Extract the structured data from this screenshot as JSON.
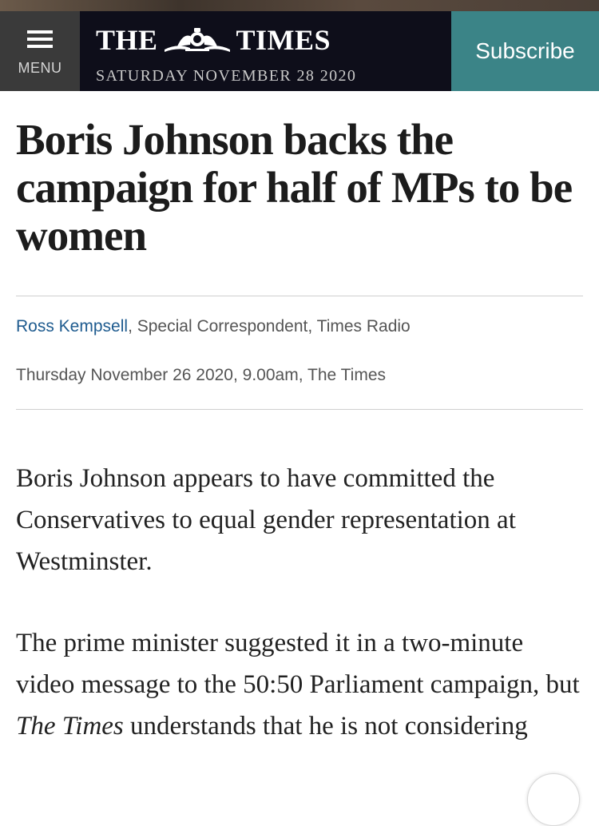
{
  "header": {
    "menu_label": "MENU",
    "logo_left": "THE",
    "logo_right": "TIMES",
    "date": "SATURDAY NOVEMBER 28 2020",
    "subscribe_label": "Subscribe"
  },
  "article": {
    "headline": "Boris Johnson backs the campaign for half of MPs to be women",
    "author": "Ross Kempsell",
    "author_role": ", Special Correspondent, Times Radio",
    "dateline": "Thursday November 26 2020, 9.00am, The Times",
    "para1": "Boris Johnson appears to have committed the Conservatives to equal gender representation at Westminster.",
    "para2_a": "The prime minister suggested it in a two-minute video message to the 50:50 Parliament campaign, but ",
    "para2_em": "The Times",
    "para2_b": " understands that he is not considering"
  },
  "colors": {
    "header_bg": "#0e0e1a",
    "menu_bg": "#3a3a3a",
    "subscribe_bg": "#3b8487",
    "author_link": "#1e5b8f"
  }
}
